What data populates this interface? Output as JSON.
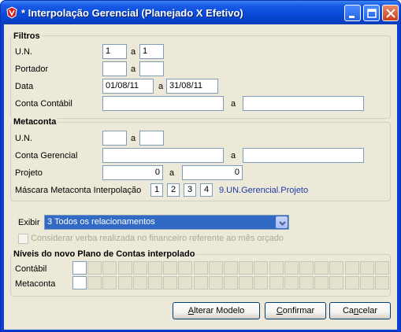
{
  "window": {
    "title": "* Interpolação Gerencial (Planejado X Efetivo)"
  },
  "filtros": {
    "title": "Filtros",
    "un_label": "U.N.",
    "un_from": "1",
    "un_to": "1",
    "portador_label": "Portador",
    "portador_from": "",
    "portador_to": "",
    "data_label": "Data",
    "data_from": "01/08/11",
    "data_to": "31/08/11",
    "conta_contabil_label": "Conta Contábil",
    "conta_contabil_from": "",
    "conta_contabil_to": "",
    "range_sep": "a"
  },
  "metaconta": {
    "title": "Metaconta",
    "un_label": "U.N.",
    "un_from": "",
    "un_to": "",
    "conta_gerencial_label": "Conta Gerencial",
    "conta_gerencial_from": "",
    "conta_gerencial_to": "",
    "projeto_label": "Projeto",
    "projeto_from": "0",
    "projeto_to": "0",
    "mascara_label": "Máscara Metaconta Interpolação",
    "mascara_boxes": [
      "1",
      "2",
      "3",
      "4"
    ],
    "mascara_value": "9.UN.Gerencial.Projeto"
  },
  "exibir": {
    "label": "Exibir",
    "selected": "3 Todos os relacionamentos"
  },
  "considerar": {
    "label": "Considerar verba realizada no financeiro referente ao mês orçado",
    "checked": false
  },
  "niveis": {
    "title": "Níveis do novo Plano de Contas interpolado",
    "contabil_label": "Contábil",
    "metaconta_label": "Metaconta"
  },
  "buttons": {
    "alterar_underline": "A",
    "alterar_rest": "lterar Modelo",
    "confirmar_underline": "C",
    "confirmar_rest": "onfirmar",
    "cancelar_first": "Ca",
    "cancelar_underline": "n",
    "cancelar_rest": "celar"
  },
  "colors": {
    "title_bar": "#0a4ddd",
    "dialog_bg": "#ece9d8",
    "selection": "#316ac5",
    "mask_text": "#1e3aa8"
  }
}
